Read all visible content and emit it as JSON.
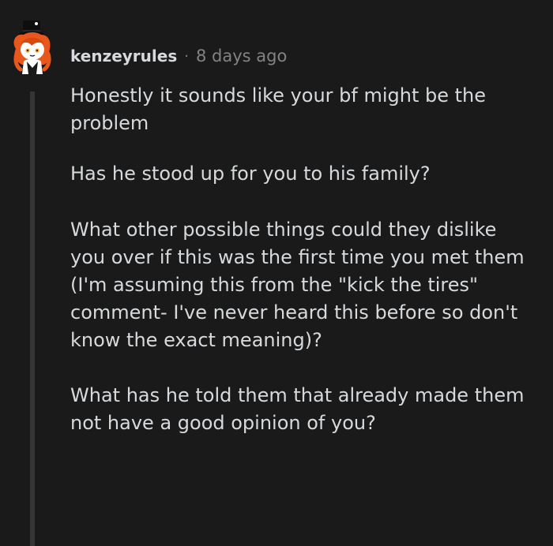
{
  "comment": {
    "author": "kenzeyrules",
    "separator": "·",
    "timestamp": "8 days ago",
    "avatar_icon": "avatar-snoo-icon",
    "paragraphs": [
      "Honestly it sounds like your bf might be the problem",
      "Has he stood up for you to his family?",
      "What other possible things could they dislike you over if this was the first time you met them (I'm assuming this from the \"kick the tires\" comment- I've never heard this before so don't know the exact meaning)?",
      "What has he told them that already made them not have a good opinion of you?"
    ]
  },
  "colors": {
    "background": "#1a1a1b",
    "text": "#d7dadc",
    "meta": "#818384",
    "thread_line": "#343536",
    "avatar_hair": "#e8581c",
    "avatar_hat": "#0e0e0e"
  }
}
